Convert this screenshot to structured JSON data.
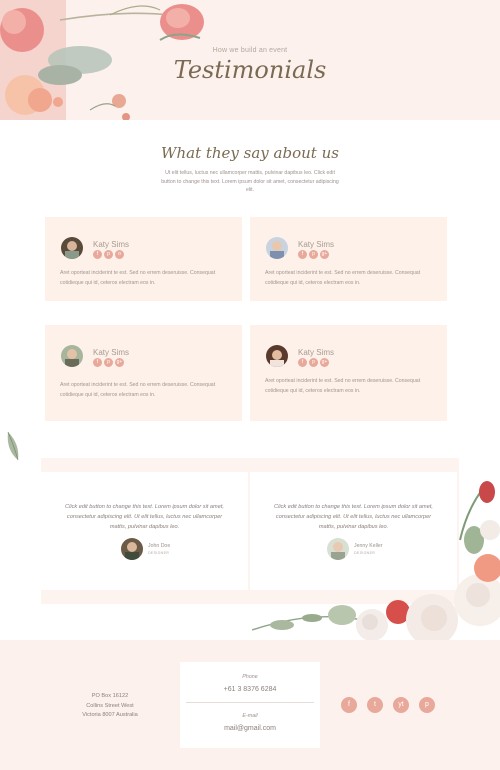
{
  "hero": {
    "subtitle": "How we build an event",
    "title": "Testimonials"
  },
  "about": {
    "title": "What they say about us",
    "text": "Ut elit tellus, luctus nec ullamcorper mattis, pulvinar dapibus leo. Click edit button to change this text. Lorem ipsum dolor sit amet, consectetur adipiscing elit."
  },
  "cards": [
    {
      "name": "Katy Sims",
      "body": "Aret oporteat inciderint te est. Sed no errem deseruisse. Consequat cotidieque qui id, ceteros electram eos in.",
      "socials": [
        "f",
        "p",
        "o"
      ]
    },
    {
      "name": "Katy Sims",
      "body": "Aret oporteat inciderint te est. Sed no errem deseruisse. Consequat cotidieque qui id, ceteros electram eos in.",
      "socials": [
        "f",
        "p",
        "g+"
      ]
    },
    {
      "name": "Katy Sims",
      "body": "Aret oporteat inciderint te est. Sed no errem deseruisse. Consequat cotidieque qui id, ceteros electram eos in.",
      "socials": [
        "f",
        "p",
        "g+"
      ]
    },
    {
      "name": "Katy Sims",
      "body": "Aret oporteat inciderint te est. Sed no errem deseruisse. Consequat cotidieque qui id, ceteros electram eos in.",
      "socials": [
        "f",
        "p",
        "g+"
      ]
    }
  ],
  "quotes": [
    {
      "text": "Click edit button to change this text. Lorem ipsum dolor sit amet, consectetur adipiscing elit. Ut elit tellus, luctus nec ullamcorper mattis, pulvinar dapibus leo.",
      "name": "John Doe",
      "role": "DESIGNER"
    },
    {
      "text": "Click edit button to change this text. Lorem ipsum dolor sit amet, consectetur adipiscing elit. Ut elit tellus, luctus nec ullamcorper mattis, pulvinar dapibus leo.",
      "name": "Jenny Keller",
      "role": "DESIGNER"
    }
  ],
  "footer": {
    "address_line1": "PO Box 16122",
    "address_line2": "Collins Street West",
    "address_line3": "Victoria 8007 Australia",
    "phone_label": "Phone",
    "phone_value": "+61 3 8376 6284",
    "email_label": "E-mail",
    "email_value": "mail@gmail.com",
    "socials": [
      "f",
      "t",
      "yt",
      "p"
    ]
  },
  "colors": {
    "accent": "#e8a89a",
    "blush_bg": "#fdf1ee",
    "title_olive": "#7a6a52"
  }
}
